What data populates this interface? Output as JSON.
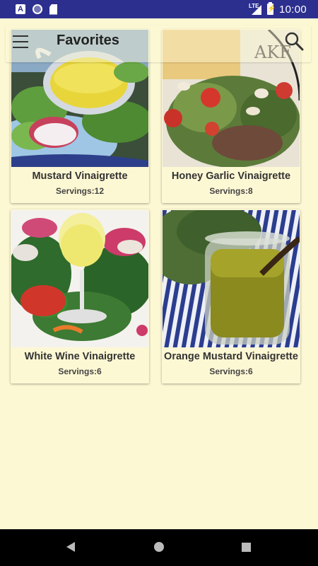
{
  "status_bar": {
    "notif_letter": "A",
    "network": "LTE",
    "time": "10:00"
  },
  "toolbar": {
    "title": "Favorites",
    "menu_icon": "hamburger-menu-icon",
    "search_icon": "search-icon"
  },
  "recipes": [
    {
      "title": "Mustard Vinaigrette",
      "servings": "Servings:12",
      "image": "mustard-vinaigrette-photo"
    },
    {
      "title": "Honey Garlic Vinaigrette",
      "servings": "Servings:8",
      "image": "honey-garlic-vinaigrette-photo"
    },
    {
      "title": "White Wine Vinaigrette",
      "servings": "Servings:6",
      "image": "white-wine-vinaigrette-photo"
    },
    {
      "title": "Orange Mustard Vinaigrette",
      "servings": "Servings:6",
      "image": "orange-mustard-vinaigrette-photo"
    }
  ],
  "colors": {
    "background": "#fdf8d4",
    "status_bar": "#2d2f8f",
    "nav_bar": "#000000"
  }
}
